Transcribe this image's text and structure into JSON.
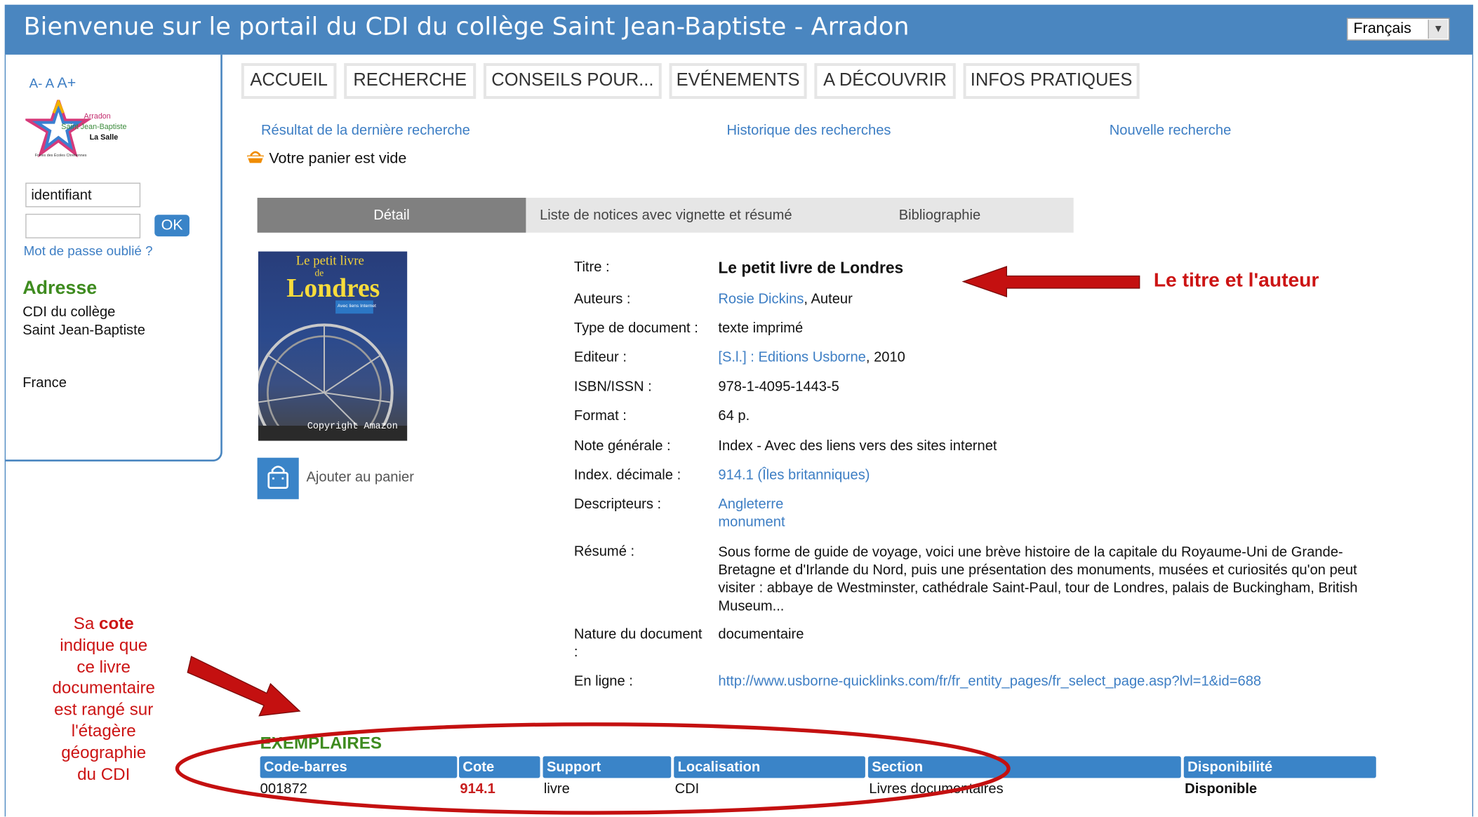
{
  "header": {
    "title": "Bienvenue sur le portail du CDI du collège Saint Jean-Baptiste - Arradon",
    "language": "Français"
  },
  "sidebar": {
    "font_controls": {
      "smaller": "A-",
      "normal": "A",
      "larger": "A+"
    },
    "logo": {
      "line1": "Arradon",
      "line2": "Saint Jean-Baptiste",
      "line3": "La Salle",
      "line4": "Frères des Écoles Chrétiennes"
    },
    "login": {
      "identifier_value": "identifiant",
      "ok": "OK",
      "forgot": "Mot de passe oublié ?"
    },
    "address": {
      "heading": "Adresse",
      "line1": "CDI du collège",
      "line2": "Saint Jean-Baptiste",
      "country": "France"
    }
  },
  "nav": [
    "ACCUEIL",
    "RECHERCHE",
    "CONSEILS POUR...",
    "EVÉNEMENTS",
    "A DÉCOUVRIR",
    "INFOS PRATIQUES"
  ],
  "search_links": {
    "last_result": "Résultat de la dernière recherche",
    "history": "Historique des recherches",
    "new": "Nouvelle recherche"
  },
  "basket": {
    "status": "Votre panier est vide",
    "add": "Ajouter au panier"
  },
  "tabs": [
    "Détail",
    "Liste de notices avec vignette et résumé",
    "Bibliographie"
  ],
  "cover": {
    "line1": "Le petit livre",
    "line2": "de",
    "line3": "Londres",
    "badge": "Avec liens Internet",
    "copyright": "Copyright Amazon"
  },
  "record": {
    "labels": {
      "title": "Titre :",
      "authors": "Auteurs :",
      "type": "Type de document :",
      "publisher": "Editeur :",
      "isbn": "ISBN/ISSN :",
      "format": "Format :",
      "note": "Note générale :",
      "index": "Index. décimale :",
      "descriptors": "Descripteurs :",
      "summary": "Résumé :",
      "nature_1": "Nature du document",
      "nature_2": ":",
      "online": "En ligne :"
    },
    "title": "Le petit livre de Londres",
    "author_name": "Rosie Dickins",
    "author_role": ", Auteur",
    "type": "texte imprimé",
    "publisher_link": "[S.l.] : Editions Usborne",
    "publisher_year": ", 2010",
    "isbn": "978-1-4095-1443-5",
    "format": "64 p.",
    "note": "Index - Avec des liens vers des sites internet",
    "index": "914.1 (Îles britanniques)",
    "descriptors": [
      "Angleterre",
      "monument"
    ],
    "summary": "Sous forme de guide de voyage, voici une brève histoire de la capitale du Royaume-Uni de Grande-Bretagne et d'Irlande du Nord, puis une présentation des monuments, musées et curiosités qu'on peut visiter : abbaye de Westminster, cathédrale Saint-Paul, tour de Londres, palais de Buckingham, British Museum...",
    "nature": "documentaire",
    "online": "http://www.usborne-quicklinks.com/fr/fr_entity_pages/fr_select_page.asp?lvl=1&id=688"
  },
  "copies": {
    "heading": "EXEMPLAIRES",
    "columns": [
      "Code-barres",
      "Cote",
      "Support",
      "Localisation",
      "Section",
      "Disponibilité"
    ],
    "row": [
      "001872",
      "914.1",
      "livre",
      "CDI",
      "Livres documentaires",
      "Disponible"
    ]
  },
  "annotations": {
    "title_author": "Le titre et l'auteur",
    "cote_l1_a": "Sa ",
    "cote_l1_b": "cote",
    "cote_rest": [
      "indique que",
      "ce livre",
      "documentaire",
      "est rangé sur",
      "l'étagère",
      "géographie",
      "du CDI"
    ]
  },
  "colors": {
    "header": "#4a86c0",
    "accent_blue": "#3a84c8",
    "green": "#3e8b1f",
    "annotation_red": "#cc1414"
  }
}
